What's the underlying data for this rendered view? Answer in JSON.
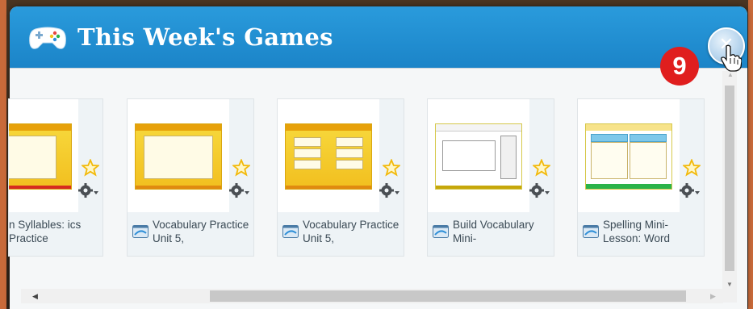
{
  "dialog": {
    "title": "This Week's Games",
    "title_icon": "game-controller-icon",
    "close_icon": "close-icon"
  },
  "step_badge": "9",
  "colors": {
    "titlebar": "#1b84c8",
    "badge": "#e01e1e",
    "thumbnail_yellow": "#f2bf1f"
  },
  "games": [
    {
      "label": "n Syllables: ics Practice",
      "thumbnail_style": "yellow-quiz"
    },
    {
      "label": "Vocabulary Practice Unit 5,",
      "thumbnail_style": "yellow-grid"
    },
    {
      "label": "Vocabulary Practice Unit 5,",
      "thumbnail_style": "yellow-match"
    },
    {
      "label": "Build Vocabulary Mini-",
      "thumbnail_style": "white-map"
    },
    {
      "label": "Spelling Mini-Lesson: Word",
      "thumbnail_style": "white-sort"
    }
  ],
  "card_icons": {
    "favorite": "star-icon",
    "options": "gear-dropdown-icon",
    "type": "game-window-icon"
  }
}
